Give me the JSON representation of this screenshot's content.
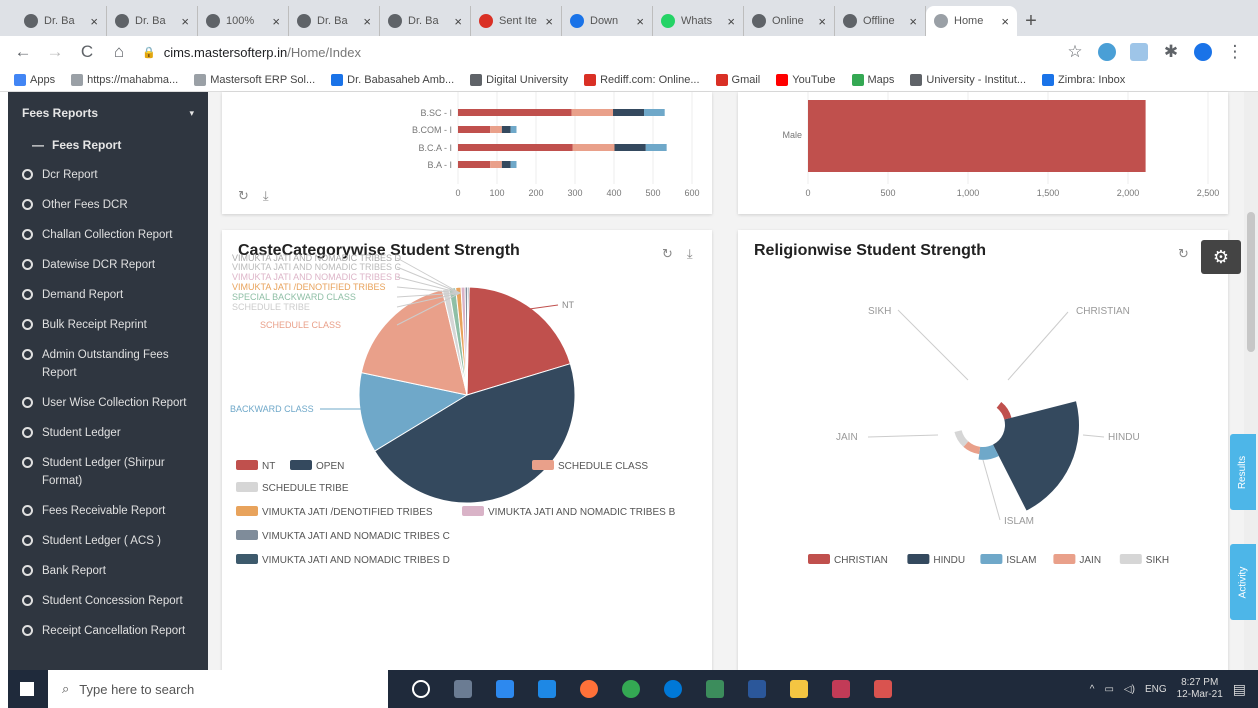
{
  "browser": {
    "tabs": [
      {
        "title": "Dr. Ba",
        "favicon_color": "#5f6368"
      },
      {
        "title": "Dr. Ba",
        "favicon_color": "#5f6368"
      },
      {
        "title": "100%",
        "favicon_color": "#5f6368"
      },
      {
        "title": "Dr. Ba",
        "favicon_color": "#5f6368"
      },
      {
        "title": "Dr. Ba",
        "favicon_color": "#5f6368"
      },
      {
        "title": "Sent Ite",
        "favicon_color": "#d93025"
      },
      {
        "title": "Down",
        "favicon_color": "#1a73e8"
      },
      {
        "title": "Whats",
        "favicon_color": "#25d366"
      },
      {
        "title": "Online",
        "favicon_color": "#5f6368"
      },
      {
        "title": "Offline",
        "favicon_color": "#5f6368"
      },
      {
        "title": "Home",
        "favicon_color": "#9aa0a6",
        "active": true
      }
    ],
    "url_host": "cims.mastersofterp.in",
    "url_path": "/Home/Index",
    "bookmarks": [
      {
        "label": "Apps",
        "color": "#4285f4"
      },
      {
        "label": "https://mahabma...",
        "color": "#9aa0a6"
      },
      {
        "label": "Mastersoft ERP Sol...",
        "color": "#9aa0a6"
      },
      {
        "label": "Dr. Babasaheb Amb...",
        "color": "#1a73e8"
      },
      {
        "label": "Digital University",
        "color": "#5f6368"
      },
      {
        "label": "Rediff.com: Online...",
        "color": "#d93025"
      },
      {
        "label": "Gmail",
        "color": "#d93025"
      },
      {
        "label": "YouTube",
        "color": "#ff0000"
      },
      {
        "label": "Maps",
        "color": "#34a853"
      },
      {
        "label": "University - Institut...",
        "color": "#5f6368"
      },
      {
        "label": "Zimbra: Inbox",
        "color": "#1a73e8"
      }
    ]
  },
  "sidebar": {
    "section": "Fees Reports",
    "submenu": "Fees Report",
    "items": [
      "Dcr Report",
      "Other Fees DCR",
      "Challan Collection Report",
      "Datewise DCR Report",
      "Demand Report",
      "Bulk Receipt Reprint",
      "Admin Outstanding Fees Report",
      "User Wise Collection Report",
      "Student Ledger",
      "Student Ledger (Shirpur Format)",
      "Fees Receivable Report",
      "Student Ledger ( ACS )",
      "Bank Report",
      "Student Concession Report",
      "Receipt Cancellation Report"
    ]
  },
  "top_left_chart": {
    "chart_data": {
      "type": "bar",
      "orientation": "horizontal",
      "stacked": true,
      "categories": [
        "B.SC - I",
        "B.COM - I",
        "B.C.A - I",
        "B.A - I"
      ],
      "values": [
        530,
        150,
        535,
        150
      ],
      "xlim": [
        0,
        600
      ],
      "xticks": [
        "0",
        "100",
        "200",
        "300",
        "400",
        "500",
        "600"
      ]
    }
  },
  "top_right_chart": {
    "chart_data": {
      "type": "bar",
      "orientation": "horizontal",
      "categories": [
        "Male"
      ],
      "values": [
        2110
      ],
      "xlim": [
        0,
        2500
      ],
      "xticks": [
        "0",
        "500",
        "1,000",
        "1,500",
        "2,000",
        "2,500"
      ],
      "color": "#c0504d"
    }
  },
  "caste_chart": {
    "title": "CasteCategorywise Student Strength",
    "chart_data": {
      "type": "pie",
      "title": "CasteCategorywise Student Strength",
      "slices": [
        {
          "label": "NT",
          "value": 20,
          "color": "#c0504d",
          "legend": "NT"
        },
        {
          "label": "OPEN",
          "value": 46,
          "color": "#34495e",
          "legend": "OPEN"
        },
        {
          "label": "BACKWARD CLASS",
          "value": 12,
          "color": "#6fa8c9",
          "legend": ""
        },
        {
          "label": "SCHEDULE CLASS",
          "value": 18,
          "color": "#e9a08a",
          "legend": "SCHEDULE CLASS"
        },
        {
          "label": "SCHEDULE TRIBE",
          "value": 1,
          "color": "#d6d6d6",
          "legend": "SCHEDULE TRIBE"
        },
        {
          "label": "SPECIAL BACKWARD CLASS",
          "value": 1,
          "color": "#8fbfa6",
          "legend": ""
        },
        {
          "label": "VIMUKTA JATI /DENOTIFIED TRIBES",
          "value": 0.8,
          "color": "#e8a35c",
          "legend": "VIMUKTA JATI /DENOTIFIED TRIBES"
        },
        {
          "label": "VIMUKTA JATI AND NOMADIC TRIBES B",
          "value": 0.6,
          "color": "#d9b3c7",
          "legend": "VIMUKTA JATI AND NOMADIC TRIBES B"
        },
        {
          "label": "VIMUKTA JATI AND NOMADIC TRIBES C",
          "value": 0.4,
          "color": "#7f8c9a",
          "legend": "VIMUKTA JATI AND NOMADIC TRIBES C"
        },
        {
          "label": "VIMUKTA JATI AND NOMADIC TRIBES D",
          "value": 0.2,
          "color": "#3d5a6c",
          "legend": "VIMUKTA JATI AND NOMADIC TRIBES D"
        }
      ],
      "pie_labels": [
        {
          "text": "NT"
        },
        {
          "text": "BACKWARD CLASS"
        },
        {
          "text": "SCHEDULE CLASS"
        },
        {
          "text": "VIMUKTA JATI AND NOMADIC TRIBES D"
        },
        {
          "text": "VIMUKTA JATI AND NOMADIC TRIBES C"
        },
        {
          "text": "VIMUKTA JATI AND NOMADIC TRIBES B"
        },
        {
          "text": "VIMUKTA JATI /DENOTIFIED TRIBES"
        },
        {
          "text": "SPECIAL BACKWARD CLASS"
        },
        {
          "text": "SCHEDULE TRIBE"
        }
      ]
    }
  },
  "religion_chart": {
    "title": "Religionwise Student Strength",
    "chart_data": {
      "type": "pie",
      "variant": "nightingale-rose",
      "title": "Religionwise Student Strength",
      "slices": [
        {
          "label": "CHRISTIAN",
          "value": 1,
          "color": "#c0504d"
        },
        {
          "label": "HINDU",
          "value": 100,
          "color": "#34495e"
        },
        {
          "label": "ISLAM",
          "value": 3,
          "color": "#6fa8c9"
        },
        {
          "label": "JAIN",
          "value": 1,
          "color": "#e9a08a"
        },
        {
          "label": "SIKH",
          "value": 1,
          "color": "#d6d6d6"
        }
      ],
      "legend": [
        "CHRISTIAN",
        "HINDU",
        "ISLAM",
        "JAIN",
        "SIKH"
      ]
    }
  },
  "right_tabs": [
    "Results",
    "Activity"
  ],
  "taskbar": {
    "search_placeholder": "Type here to search",
    "time": "8:27 PM",
    "date": "12-Mar-21",
    "lang": "ENG"
  }
}
